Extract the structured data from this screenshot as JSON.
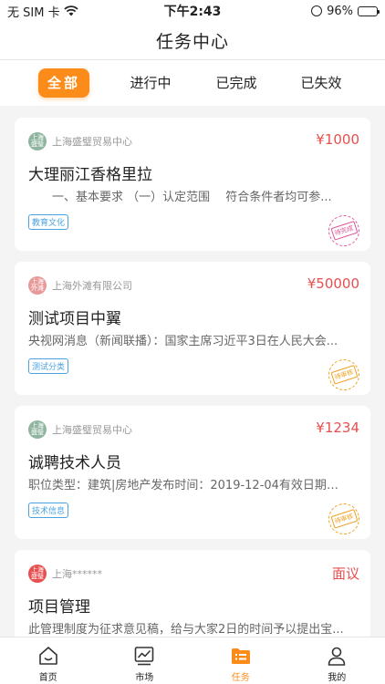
{
  "status_bar": {
    "carrier": "无 SIM 卡",
    "time": "下午2:43",
    "battery": "96%",
    "battery_level": 0.96
  },
  "nav": {
    "title": "任务中心"
  },
  "tabs": [
    {
      "label": "全部",
      "active": true
    },
    {
      "label": "进行中",
      "active": false
    },
    {
      "label": "已完成",
      "active": false
    },
    {
      "label": "已失效",
      "active": false
    }
  ],
  "tasks": [
    {
      "company_logo": "上海盛璧",
      "company_logo_color": "#8fb59f",
      "company": "上海盛璧贸易中心",
      "price": "¥1000",
      "title": "大理丽江香格里拉",
      "desc": "　　一、基本要求 （一）认定范围　 符合条件者均可参...",
      "tag": "教育文化",
      "stamp": "待完成",
      "stamp_color": "#e0559a"
    },
    {
      "company_logo": "上海外滩",
      "company_logo_color": "#e89a9a",
      "company": "上海外滩有限公司",
      "price": "¥50000",
      "title": "测试项目中翼",
      "desc": "央视网消息（新闻联播）：国家主席习近平3日在人民大会...",
      "tag": "测试分类",
      "stamp": "待审核",
      "stamp_color": "#f0a020"
    },
    {
      "company_logo": "上海盛璧",
      "company_logo_color": "#8fb59f",
      "company": "上海盛璧贸易中心",
      "price": "¥1234",
      "title": "诚聘技术人员",
      "desc": "职位类型：建筑|房地产发布时间：2019-12-04有效日期：...",
      "tag": "技术信息",
      "stamp": "待审核",
      "stamp_color": "#f0a020"
    },
    {
      "company_logo": "上海盛璧",
      "company_logo_color": "#e84f4f",
      "company": "上海******",
      "price": "面议",
      "title": "项目管理",
      "desc": "此管理制度为征求意见稿，给与大家2日的时间予以提出宝...",
      "tag": "",
      "stamp": "",
      "stamp_color": "#f0a020"
    }
  ],
  "bottom_nav": [
    {
      "label": "首页",
      "icon": "home-icon",
      "active": false
    },
    {
      "label": "市场",
      "icon": "market-chart-icon",
      "active": false
    },
    {
      "label": "任务",
      "icon": "task-list-icon",
      "active": true
    },
    {
      "label": "我的",
      "icon": "profile-icon",
      "active": false
    }
  ],
  "colors": {
    "accent": "#fc8c19",
    "price": "#e84f4f",
    "tag": "#4aa3e0"
  }
}
